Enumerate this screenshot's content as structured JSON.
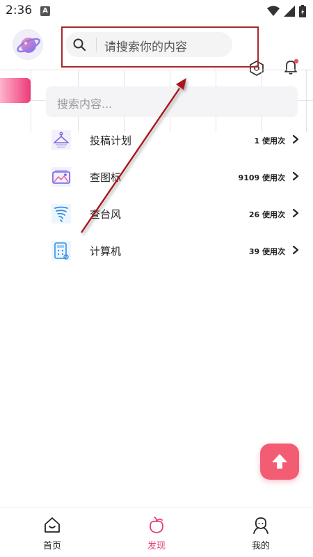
{
  "status_bar": {
    "time": "2:36",
    "notification_letter": "A"
  },
  "header": {
    "search_placeholder": "请搜索你的内容"
  },
  "inner_search": {
    "placeholder": "搜索内容..."
  },
  "tools": [
    {
      "name": "投稿计划",
      "count": "1 使用次",
      "icon": "hanger-icon"
    },
    {
      "name": "查图标",
      "count": "9109 使用次",
      "icon": "image-gallery-icon"
    },
    {
      "name": "查台风",
      "count": "26 使用次",
      "icon": "typhoon-icon"
    },
    {
      "name": "计算机",
      "count": "39 使用次",
      "icon": "calculator-icon"
    }
  ],
  "bottom_nav": {
    "items": [
      {
        "label": "首页",
        "icon": "home-icon",
        "active": false
      },
      {
        "label": "发现",
        "icon": "peach-icon",
        "active": true
      },
      {
        "label": "我的",
        "icon": "profile-icon",
        "active": false
      }
    ]
  },
  "colors": {
    "accent": "#e8407a",
    "fab": "#f35d73",
    "annotation": "#a8262e"
  }
}
